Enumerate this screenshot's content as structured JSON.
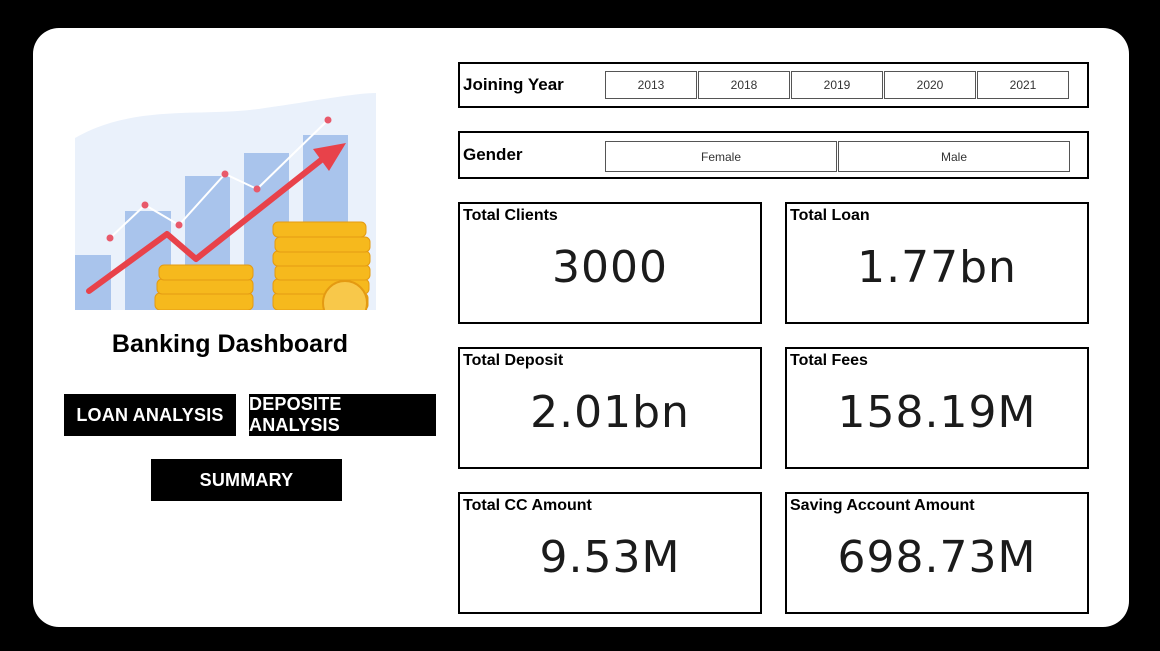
{
  "sidebar": {
    "title": "Banking Dashboard",
    "buttons": {
      "loan": "LOAN ANALYSIS",
      "deposit": "DEPOSITE ANALYSIS",
      "summary": "SUMMARY"
    }
  },
  "filters": {
    "joining_year": {
      "label": "Joining Year",
      "options": [
        "2013",
        "2018",
        "2019",
        "2020",
        "2021"
      ]
    },
    "gender": {
      "label": "Gender",
      "options": [
        "Female",
        "Male"
      ]
    }
  },
  "kpis": [
    {
      "label": "Total Clients",
      "value": "3000"
    },
    {
      "label": "Total Loan",
      "value": "1.77bn"
    },
    {
      "label": "Total Deposit",
      "value": "2.01bn"
    },
    {
      "label": "Total Fees",
      "value": "158.19M"
    },
    {
      "label": "Total CC Amount",
      "value": "9.53M"
    },
    {
      "label": "Saving Account Amount",
      "value": "698.73M"
    }
  ],
  "colors": {
    "background": "#000000",
    "card": "#ffffff",
    "button": "#000000",
    "arrow": "#e8424a",
    "bars": "#a9c4ec",
    "coins": "#f6b91d"
  }
}
